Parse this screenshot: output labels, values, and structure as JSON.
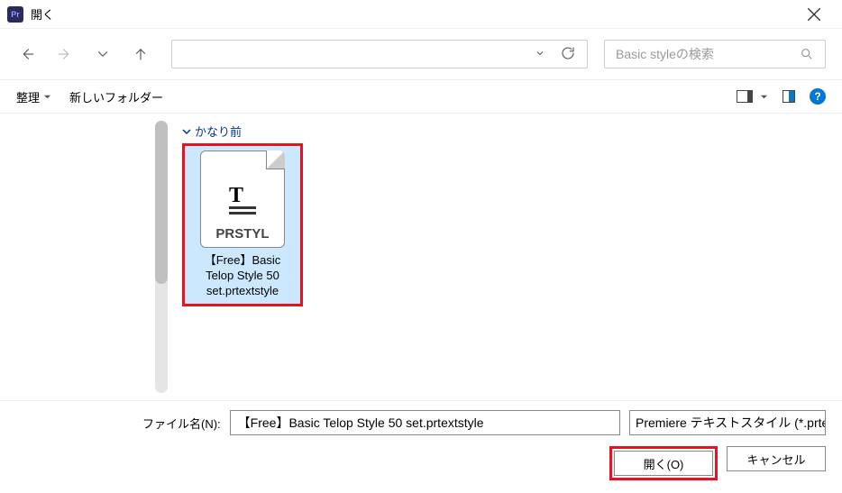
{
  "title_bar": {
    "app_label": "Pr",
    "title": "開く"
  },
  "search": {
    "placeholder": "Basic styleの検索"
  },
  "toolbar": {
    "organize": "整理",
    "new_folder": "新しいフォルダー"
  },
  "content": {
    "group_label": "かなり前",
    "file": {
      "name": "【Free】Basic Telop Style 50 set.prtextstyle",
      "ext_label": "PRSTYL"
    }
  },
  "bottom": {
    "filename_label": "ファイル名(N):",
    "filename_value": "【Free】Basic Telop Style 50 set.prtextstyle",
    "filter": "Premiere テキストスタイル (*.prtext",
    "open_btn": "開く(O)",
    "cancel_btn": "キャンセル"
  }
}
